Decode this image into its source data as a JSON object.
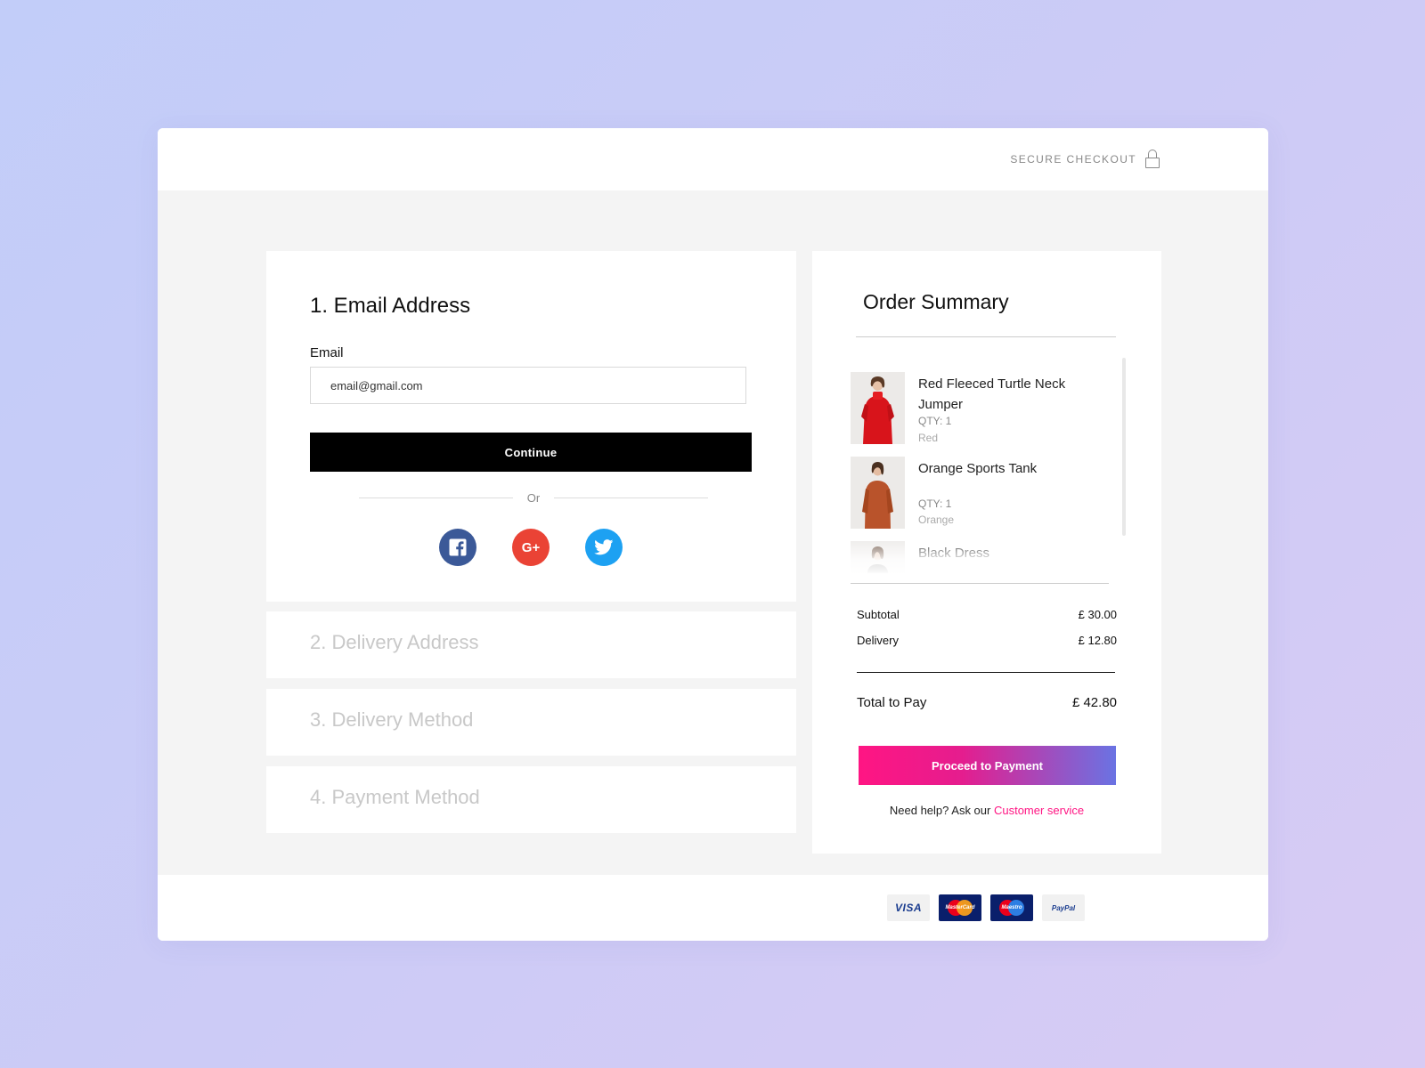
{
  "header": {
    "secure_label": "SECURE CHECKOUT",
    "lock_icon": "lock-icon"
  },
  "steps": {
    "email": {
      "title": "1. Email Address",
      "field_label": "Email",
      "field_value": "email@gmail.com",
      "continue_label": "Continue",
      "or_label": "Or",
      "socials": [
        "facebook-icon",
        "google-plus-icon",
        "twitter-icon"
      ],
      "google_plus_glyph": "G+"
    },
    "delivery_address": "2. Delivery Address",
    "delivery_method": "3. Delivery Method",
    "payment_method": "4. Payment Method"
  },
  "summary": {
    "title": "Order Summary",
    "items": [
      {
        "name": "Red Fleeced Turtle Neck Jumper",
        "qty": "QTY: 1",
        "color": "Red"
      },
      {
        "name": "Orange Sports Tank",
        "qty": "QTY: 1",
        "color": "Orange"
      },
      {
        "name": "Black Dress",
        "qty": "",
        "color": ""
      }
    ],
    "subtotal_label": "Subtotal",
    "subtotal_value": "£ 30.00",
    "delivery_label": "Delivery",
    "delivery_value": "£ 12.80",
    "total_label": "Total to Pay",
    "total_value": "£ 42.80",
    "pay_label": "Proceed to Payment",
    "help_text": "Need help? Ask our",
    "help_link": "Customer service"
  },
  "footer": {
    "cards": [
      {
        "name": "VISA"
      },
      {
        "name": "MasterCard"
      },
      {
        "name": "Maestro"
      },
      {
        "name": "PayPal"
      }
    ]
  },
  "colors": {
    "accent_pink": "#ff1583",
    "facebook": "#3b5998",
    "google": "#ea4335",
    "twitter": "#1da1f2"
  }
}
